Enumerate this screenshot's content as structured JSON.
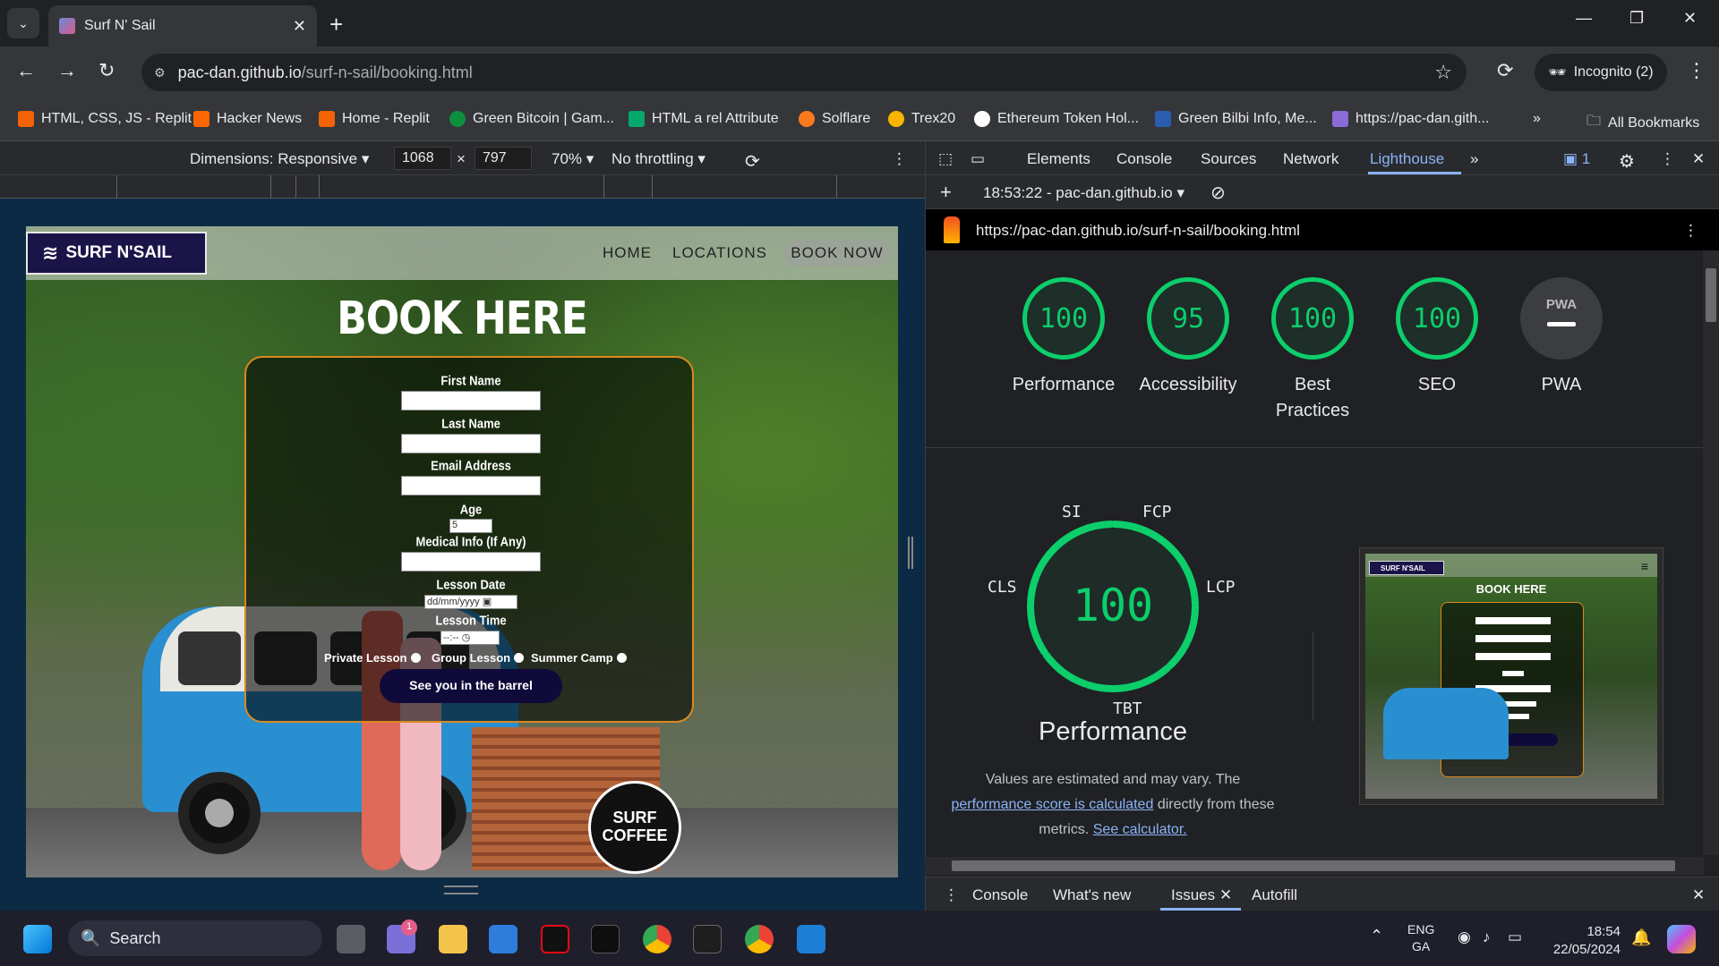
{
  "browser": {
    "tab_title": "Surf N' Sail",
    "url_host": "pac-dan.github.io",
    "url_path": "/surf-n-sail/booking.html",
    "incognito_label": "Incognito (2)"
  },
  "bookmarks": [
    {
      "label": "HTML, CSS, JS - Replit",
      "color": "#f26207"
    },
    {
      "label": "Hacker News",
      "color": "#ff6600"
    },
    {
      "label": "Home - Replit",
      "color": "#f26207"
    },
    {
      "label": "Green Bitcoin | Gam...",
      "color": "#0e8f3e"
    },
    {
      "label": "HTML a rel Attribute",
      "color": "#04aa6d"
    },
    {
      "label": "Solflare",
      "color": "#fc7a1e"
    },
    {
      "label": "Trex20",
      "color": "#f7b500"
    },
    {
      "label": "Ethereum Token Hol...",
      "color": "#ffffff"
    },
    {
      "label": "Green Bilbi Info, Me...",
      "color": "#2a5db0"
    },
    {
      "label": "https://pac-dan.gith...",
      "color": "#8a6bd8"
    }
  ],
  "all_bookmarks_label": "All Bookmarks",
  "device_toolbar": {
    "dimensions_label": "Dimensions: Responsive",
    "width": "1068",
    "height": "797",
    "zoom": "70%",
    "throttle": "No throttling"
  },
  "site": {
    "logo_text": "SURF N'SAIL",
    "nav": [
      "HOME",
      "LOCATIONS",
      "BOOK NOW"
    ],
    "heading": "BOOK HERE",
    "form": {
      "first_name_label": "First Name",
      "last_name_label": "Last Name",
      "email_label": "Email Address",
      "age_label": "Age",
      "age_value": "5",
      "medical_label": "Medical Info (If Any)",
      "date_label": "Lesson Date",
      "date_placeholder": "dd/mm/yyyy",
      "time_label": "Lesson Time",
      "time_placeholder": "--:--",
      "radio_options": [
        "Private Lesson",
        "Group Lesson",
        "Summer Camp"
      ],
      "submit_label": "See you in the barrel"
    },
    "scene_sign": "SURF COFFEE"
  },
  "devtools": {
    "tabs": [
      "Elements",
      "Console",
      "Sources",
      "Network",
      "Lighthouse"
    ],
    "active_tab": "Lighthouse",
    "issues_count": "1",
    "report_time": "18:53:22 - pac-dan.github.io",
    "report_url": "https://pac-dan.github.io/surf-n-sail/booking.html",
    "scores": [
      {
        "label": "Performance",
        "value": "100"
      },
      {
        "label": "Accessibility",
        "value": "95"
      },
      {
        "label": "Best Practices",
        "value": "100"
      },
      {
        "label": "SEO",
        "value": "100"
      }
    ],
    "pwa_label": "PWA",
    "pwa_badge": "PWA",
    "perf_score": "100",
    "metrics": [
      "SI",
      "FCP",
      "CLS",
      "LCP",
      "TBT"
    ],
    "perf_title": "Performance",
    "note_1": "Values are estimated and may vary. The",
    "note_link_1": "performance score is calculated",
    "note_2": "directly from these metrics.",
    "note_link_2": "See calculator.",
    "drawer_tabs": [
      "Console",
      "What's new",
      "Issues",
      "Autofill"
    ],
    "thumb_logo": "SURF N'SAIL",
    "thumb_heading": "BOOK HERE"
  },
  "taskbar": {
    "search_label": "Search",
    "lang_1": "ENG",
    "lang_2": "GA",
    "time": "18:54",
    "date": "22/05/2024",
    "badge": "1"
  },
  "colors": {
    "score_green": "#0cce6b",
    "form_border": "#d9891f",
    "logo_bg": "#1a1448",
    "devtools_accent": "#8ab4f8"
  }
}
